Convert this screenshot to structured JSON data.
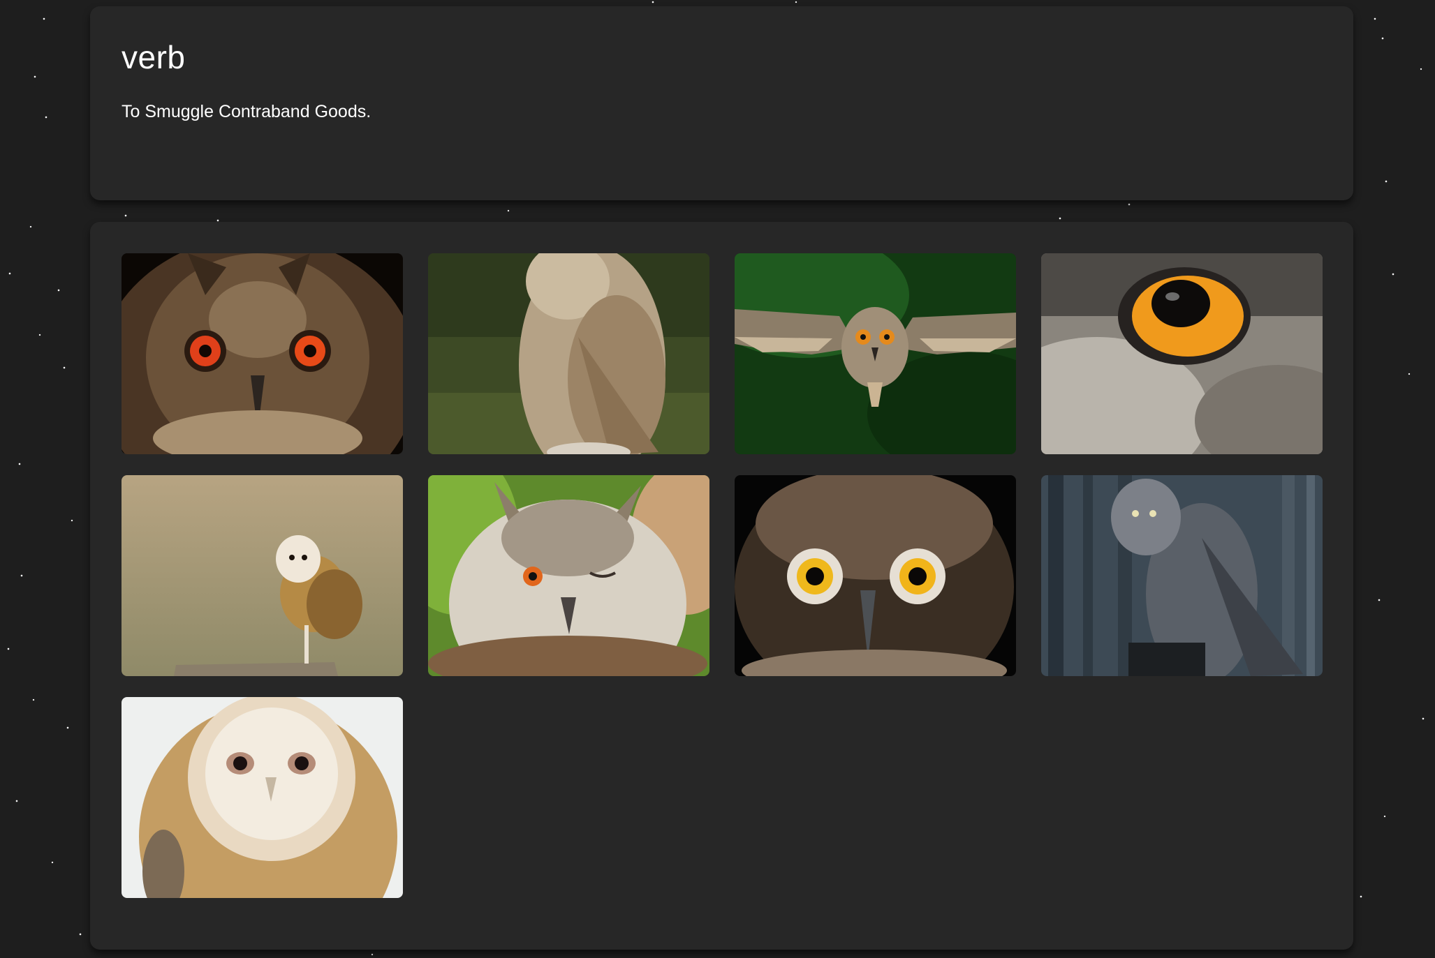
{
  "definition": {
    "part_of_speech": "verb",
    "text": "To Smuggle Contraband Goods."
  },
  "gallery": {
    "images": [
      {
        "icon": "owl-orange-eyes-closeup-icon"
      },
      {
        "icon": "owl-standing-grass-icon"
      },
      {
        "icon": "owl-flying-icon"
      },
      {
        "icon": "owl-eye-macro-icon"
      },
      {
        "icon": "barn-owl-perched-icon"
      },
      {
        "icon": "owl-winking-icon"
      },
      {
        "icon": "owl-yellow-eyes-closeup-icon"
      },
      {
        "icon": "great-grey-owl-forest-icon"
      },
      {
        "icon": "barn-owl-face-icon"
      }
    ]
  },
  "colors": {
    "page_background": "#1e1e1e",
    "card_background": "#272727",
    "text": "#ffffff"
  }
}
